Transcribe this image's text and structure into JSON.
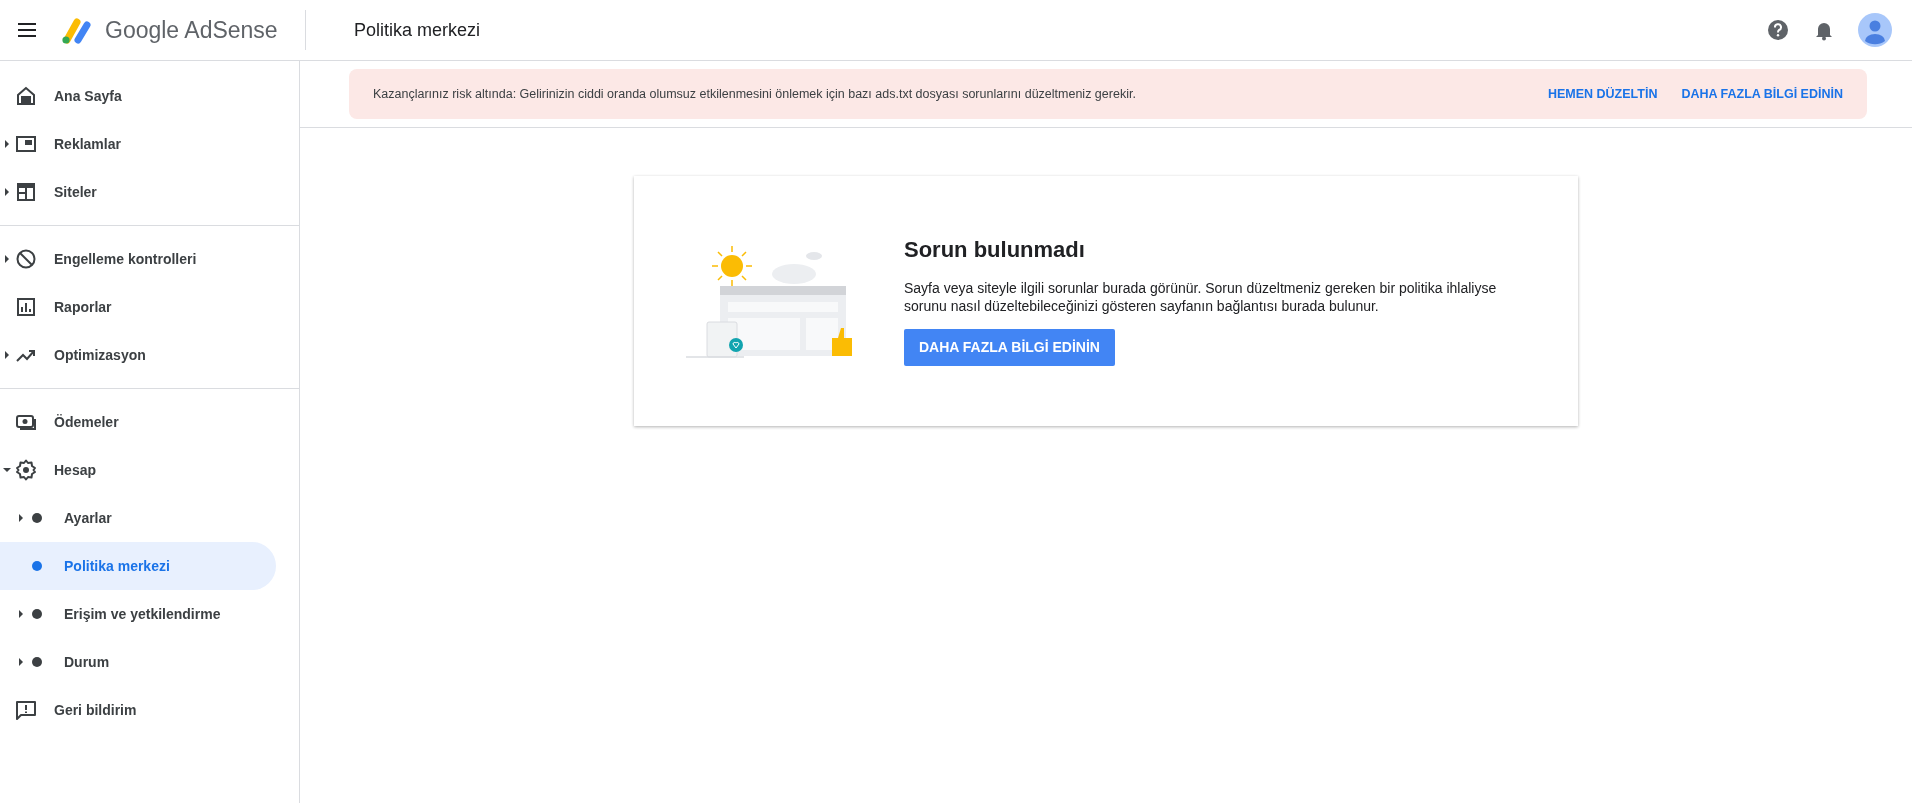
{
  "header": {
    "brand": "Google AdSense",
    "page_title": "Politika merkezi"
  },
  "sidebar": {
    "groups": [
      {
        "items": [
          {
            "label": "Ana Sayfa",
            "selected": false
          },
          {
            "label": "Reklamlar",
            "expanded": false,
            "selected": false
          },
          {
            "label": "Siteler",
            "expanded": false,
            "selected": false
          }
        ]
      },
      {
        "items": [
          {
            "label": "Engelleme kontrolleri",
            "expanded": false,
            "selected": false
          },
          {
            "label": "Raporlar",
            "selected": false
          },
          {
            "label": "Optimizasyon",
            "expanded": false,
            "selected": false
          }
        ]
      },
      {
        "items": [
          {
            "label": "Ödemeler",
            "selected": false
          },
          {
            "label": "Hesap",
            "expanded": true,
            "selected": false,
            "children": [
              {
                "label": "Ayarlar",
                "expanded": false,
                "selected": false
              },
              {
                "label": "Politika merkezi",
                "selected": true
              },
              {
                "label": "Erişim ve yetkilendirme",
                "expanded": false,
                "selected": false
              },
              {
                "label": "Durum",
                "expanded": false,
                "selected": false
              }
            ]
          },
          {
            "label": "Geri bildirim",
            "selected": false
          }
        ]
      }
    ]
  },
  "banner": {
    "message": "Kazançlarınız risk altında: Gelirinizin ciddi oranda olumsuz etkilenmesini önlemek için bazı ads.txt dosyası sorunlarını düzeltmeniz gerekir.",
    "actions": [
      "HEMEN DÜZELTİN",
      "DAHA FAZLA BİLGİ EDİNİN"
    ]
  },
  "card": {
    "title": "Sorun bulunmadı",
    "body": "Sayfa veya siteyle ilgili sorunlar burada görünür. Sorun düzeltmeniz gereken bir politika ihlaliyse sorunu nasıl düzeltebileceğinizi gösteren sayfanın bağlantısı burada bulunur.",
    "button": "DAHA FAZLA BİLGİ EDİNİN"
  }
}
